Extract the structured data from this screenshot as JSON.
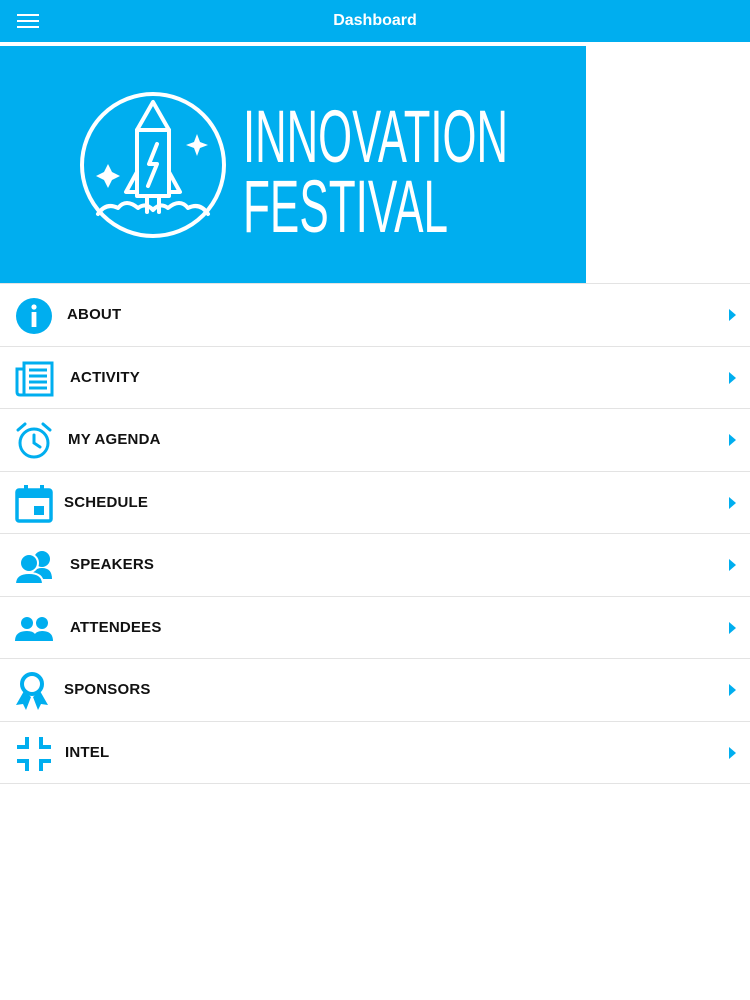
{
  "header": {
    "title": "Dashboard",
    "menu_icon": "hamburger-menu-icon",
    "background": "#00aeef"
  },
  "banner": {
    "line1": "INNOVATION",
    "line2": "FESTIVAL",
    "logo_icon": "rocket-logo-icon",
    "background": "#00aeef"
  },
  "accent": "#00aeef",
  "menu": {
    "items": [
      {
        "label": "ABOUT",
        "icon": "info-icon"
      },
      {
        "label": "ACTIVITY",
        "icon": "newspaper-icon"
      },
      {
        "label": "MY AGENDA",
        "icon": "alarm-clock-icon"
      },
      {
        "label": "SCHEDULE",
        "icon": "calendar-icon"
      },
      {
        "label": "SPEAKERS",
        "icon": "speakers-icon"
      },
      {
        "label": "ATTENDEES",
        "icon": "people-icon"
      },
      {
        "label": "SPONSORS",
        "icon": "ribbon-award-icon"
      },
      {
        "label": "INTEL",
        "icon": "compress-icon"
      }
    ]
  }
}
